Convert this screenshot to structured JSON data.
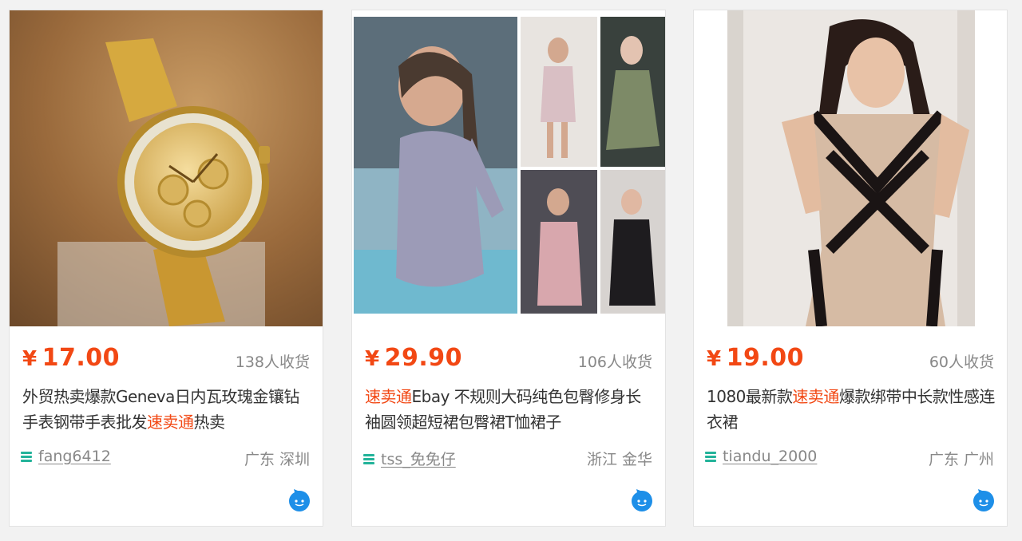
{
  "products": [
    {
      "currency": "¥",
      "price": "17.00",
      "sold": "138人收货",
      "title_plain_1": "外贸热卖爆款Geneva日内瓦玫瑰金镶钻手表钢带手表批发",
      "title_highlight": "速卖通",
      "title_plain_2": "热卖",
      "shop": "fang6412",
      "location": "广东 深圳",
      "image_subject": "gold wristwatch"
    },
    {
      "currency": "¥",
      "price": "29.90",
      "sold": "106人收货",
      "title_highlight": "速卖通",
      "title_plain_1": "Ebay 不规则大码纯色包臀修身长袖圆领超短裙包臀裙T恤裙子",
      "shop": "tss_免免仔",
      "location": "浙江 金华",
      "image_subject": "bodycon long-sleeve dress collage"
    },
    {
      "currency": "¥",
      "price": "19.00",
      "sold": "60人收货",
      "title_plain_1": "1080最新款",
      "title_highlight": "速卖通",
      "title_plain_2": "爆款绑带中长款性感连衣裙",
      "shop": "tiandu_2000",
      "location": "广东 广州",
      "image_subject": "bandage bodycon dress"
    }
  ],
  "colors": {
    "price": "#f24814",
    "highlight": "#f24814",
    "wangwang_icon": "#23b39a",
    "chat_icon": "#1e8fe8"
  },
  "icons": {
    "shop": "wangwang-icon",
    "chat": "chat-bubble-icon"
  }
}
